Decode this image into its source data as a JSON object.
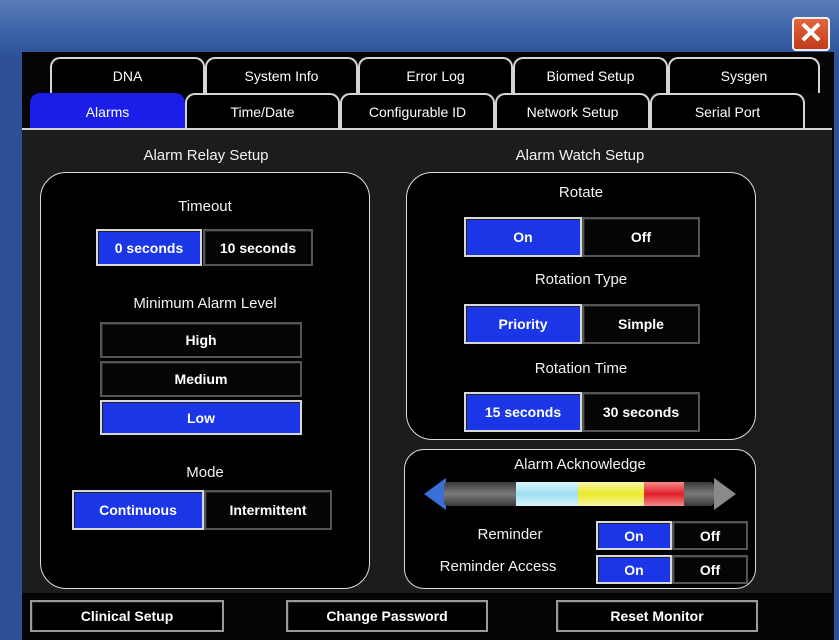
{
  "window": {
    "close_label": "✕"
  },
  "tabs_row1": [
    "DNA",
    "System Info",
    "Error Log",
    "Biomed Setup",
    "Sysgen"
  ],
  "tabs_row2": [
    "Alarms",
    "Time/Date",
    "Configurable ID",
    "Network Setup",
    "Serial Port"
  ],
  "active_tab": "Alarms",
  "relay": {
    "title": "Alarm Relay Setup",
    "timeout_label": "Timeout",
    "timeout_options": [
      "0 seconds",
      "10 seconds"
    ],
    "timeout_selected": "0 seconds",
    "min_level_label": "Minimum Alarm Level",
    "level_options": [
      "High",
      "Medium",
      "Low"
    ],
    "level_selected": "Low",
    "mode_label": "Mode",
    "mode_options": [
      "Continuous",
      "Intermittent"
    ],
    "mode_selected": "Continuous"
  },
  "watch": {
    "title": "Alarm Watch Setup",
    "rotate_label": "Rotate",
    "rotate_options": [
      "On",
      "Off"
    ],
    "rotate_selected": "On",
    "rotation_type_label": "Rotation Type",
    "rotation_type_options": [
      "Priority",
      "Simple"
    ],
    "rotation_type_selected": "Priority",
    "rotation_time_label": "Rotation Time",
    "rotation_time_options": [
      "15 seconds",
      "30 seconds"
    ],
    "rotation_time_selected": "15 seconds"
  },
  "ack": {
    "title": "Alarm Acknowledge",
    "slider_colors": [
      "#4a4a4a",
      "#a8e4f2",
      "#f0ef3a",
      "#e52530",
      "#4a4a4a"
    ],
    "reminder_label": "Reminder",
    "reminder_options": [
      "On",
      "Off"
    ],
    "reminder_selected": "On",
    "reminder_access_label": "Reminder Access",
    "reminder_access_options": [
      "On",
      "Off"
    ],
    "reminder_access_selected": "On"
  },
  "footer": {
    "clinical_setup": "Clinical Setup",
    "change_password": "Change Password",
    "reset_monitor": "Reset Monitor"
  }
}
